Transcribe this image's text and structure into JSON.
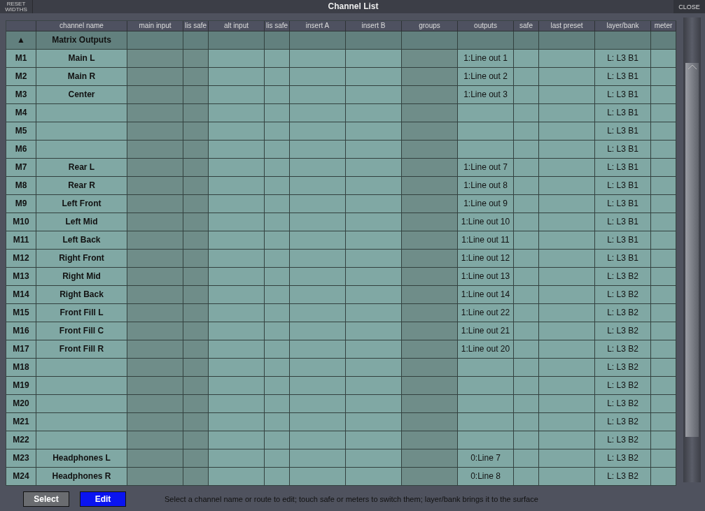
{
  "window": {
    "title": "Channel List",
    "reset_button": "RESET\nWIDTHS",
    "close_button": "CLOSE"
  },
  "table": {
    "columns": [
      {
        "shaded": false
      },
      {
        "label": "channel name",
        "shaded": false
      },
      {
        "label": "main input",
        "shaded": true
      },
      {
        "label": "lis safe",
        "shaded": true
      },
      {
        "label": "alt input",
        "shaded": false
      },
      {
        "label": "lis safe",
        "shaded": false
      },
      {
        "label": "insert A",
        "shaded": false
      },
      {
        "label": "insert B",
        "shaded": false
      },
      {
        "label": "groups",
        "shaded": true
      },
      {
        "label": "outputs",
        "shaded": false
      },
      {
        "label": "safe",
        "shaded": false
      },
      {
        "label": "last preset",
        "shaded": false
      },
      {
        "label": "layer/bank",
        "shaded": false
      },
      {
        "label": "meter",
        "shaded": false
      }
    ],
    "group_row": {
      "toggle": "▲",
      "name": "Matrix Outputs"
    },
    "rows": [
      {
        "id": "M1",
        "name": "Main L",
        "output": "1:Line out 1",
        "layer": "L: L3 B1"
      },
      {
        "id": "M2",
        "name": "Main R",
        "output": "1:Line out 2",
        "layer": "L: L3 B1"
      },
      {
        "id": "M3",
        "name": "Center",
        "output": "1:Line out 3",
        "layer": "L: L3 B1"
      },
      {
        "id": "M4",
        "layer": "L: L3 B1"
      },
      {
        "id": "M5",
        "layer": "L: L3 B1"
      },
      {
        "id": "M6",
        "layer": "L: L3 B1"
      },
      {
        "id": "M7",
        "name": "Rear L",
        "output": "1:Line out 7",
        "layer": "L: L3 B1"
      },
      {
        "id": "M8",
        "name": "Rear R",
        "output": "1:Line out 8",
        "layer": "L: L3 B1"
      },
      {
        "id": "M9",
        "name": "Left Front",
        "output": "1:Line out 9",
        "layer": "L: L3 B1"
      },
      {
        "id": "M10",
        "name": "Left Mid",
        "output": "1:Line out 10",
        "layer": "L: L3 B1"
      },
      {
        "id": "M11",
        "name": "Left Back",
        "output": "1:Line out 11",
        "layer": "L: L3 B1"
      },
      {
        "id": "M12",
        "name": "Right Front",
        "output": "1:Line out 12",
        "layer": "L: L3 B1"
      },
      {
        "id": "M13",
        "name": "Right Mid",
        "output": "1:Line out 13",
        "layer": "L: L3 B2"
      },
      {
        "id": "M14",
        "name": "Right Back",
        "output": "1:Line out 14",
        "layer": "L: L3 B2"
      },
      {
        "id": "M15",
        "name": "Front Fill L",
        "output": "1:Line out 22",
        "layer": "L: L3 B2"
      },
      {
        "id": "M16",
        "name": "Front Fill C",
        "output": "1:Line out 21",
        "layer": "L: L3 B2"
      },
      {
        "id": "M17",
        "name": "Front Fill R",
        "output": "1:Line out 20",
        "layer": "L: L3 B2"
      },
      {
        "id": "M18",
        "layer": "L: L3 B2"
      },
      {
        "id": "M19",
        "layer": "L: L3 B2"
      },
      {
        "id": "M20",
        "layer": "L: L3 B2"
      },
      {
        "id": "M21",
        "layer": "L: L3 B2"
      },
      {
        "id": "M22",
        "layer": "L: L3 B2"
      },
      {
        "id": "M23",
        "name": "Headphones L",
        "output": "0:Line 7",
        "layer": "L: L3 B2"
      },
      {
        "id": "M24",
        "name": "Headphones R",
        "output": "0:Line 8",
        "layer": "L: L3 B2"
      }
    ]
  },
  "footer": {
    "buttons": [
      {
        "label": "Select",
        "selected": false
      },
      {
        "label": "Edit",
        "selected": true
      }
    ],
    "hint": "Select a channel name or route to edit; touch safe or meters to switch them; layer/bank brings it to the surface"
  }
}
